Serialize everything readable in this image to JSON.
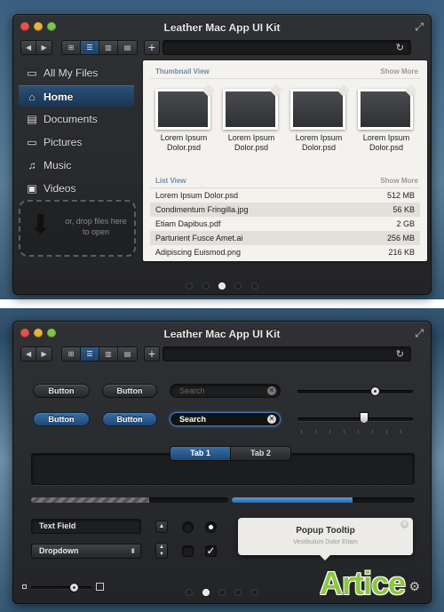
{
  "window_title": "Leather Mac App UI Kit",
  "toolbar": {
    "back": "◀",
    "forward": "▶",
    "views": [
      "⊞",
      "☰",
      "▥",
      "▤"
    ],
    "add": "+",
    "refresh": "↻"
  },
  "sidebar": {
    "items": [
      {
        "label": "All My Files",
        "icon": "folder-icon",
        "glyph": "▭"
      },
      {
        "label": "Home",
        "icon": "home-icon",
        "glyph": "⌂"
      },
      {
        "label": "Documents",
        "icon": "document-icon",
        "glyph": "▤"
      },
      {
        "label": "Pictures",
        "icon": "pictures-icon",
        "glyph": "▭"
      },
      {
        "label": "Music",
        "icon": "music-icon",
        "glyph": "♫"
      },
      {
        "label": "Videos",
        "icon": "film-icon",
        "glyph": "▣"
      }
    ],
    "selected": "Home",
    "dropzone_text": "or, drop files here to open",
    "dropzone_arrow": "⬇"
  },
  "thumbnail_view": {
    "title": "Thumbnail View",
    "show_more": "Show More",
    "items": [
      "Lorem Ipsum Dolor.psd",
      "Lorem Ipsum Dolor.psd",
      "Lorem Ipsum Dolor.psd",
      "Lorem Ipsum Dolor.psd"
    ]
  },
  "list_view": {
    "title": "List View",
    "show_more": "Show More",
    "rows": [
      {
        "name": "Lorem Ipsum Dolor.psd",
        "size": "512 MB"
      },
      {
        "name": "Condimentum Fringilla.jpg",
        "size": "56 KB"
      },
      {
        "name": "Etiam Dapibus.pdf",
        "size": "2 GB"
      },
      {
        "name": "Parturient Fusce Amet.ai",
        "size": "256 MB"
      },
      {
        "name": "Adipiscing Euismod.png",
        "size": "216 KB"
      }
    ]
  },
  "page_dots": {
    "count": 5,
    "active_index_top": 2,
    "active_index_bottom": 1
  },
  "controls": {
    "button_label": "Button",
    "search_placeholder": "Search",
    "search_value": "Search",
    "clear": "✕",
    "tabs": [
      "Tab 1",
      "Tab 2"
    ],
    "active_tab": "Tab 1",
    "progress_striped": 0.6,
    "progress_blue": 0.66,
    "slider1_value": 0.67,
    "slider2_value": 0.58,
    "text_field_value": "Text Field",
    "dropdown_value": "Dropdown",
    "dropdown_caret": "⬍",
    "up_arrow": "▲",
    "stepper_up": "▲",
    "stepper_down": "▼",
    "radio_checked": true,
    "checkbox_checked": true,
    "checkmark": "✓",
    "bottom_slider_value": 0.75,
    "gear": "⚙",
    "expand": "⤢"
  },
  "tooltip": {
    "title": "Popup Tooltip",
    "subtitle": "Vestibulum Dolor Etiam",
    "close": "✕"
  },
  "watermark": "Artice",
  "colors": {
    "accent_blue": "#2f68a3",
    "traffic_red": "#e6514b",
    "traffic_yellow": "#e9b23a",
    "traffic_green": "#7ec34a",
    "watermark_green": "#8cc63f"
  }
}
